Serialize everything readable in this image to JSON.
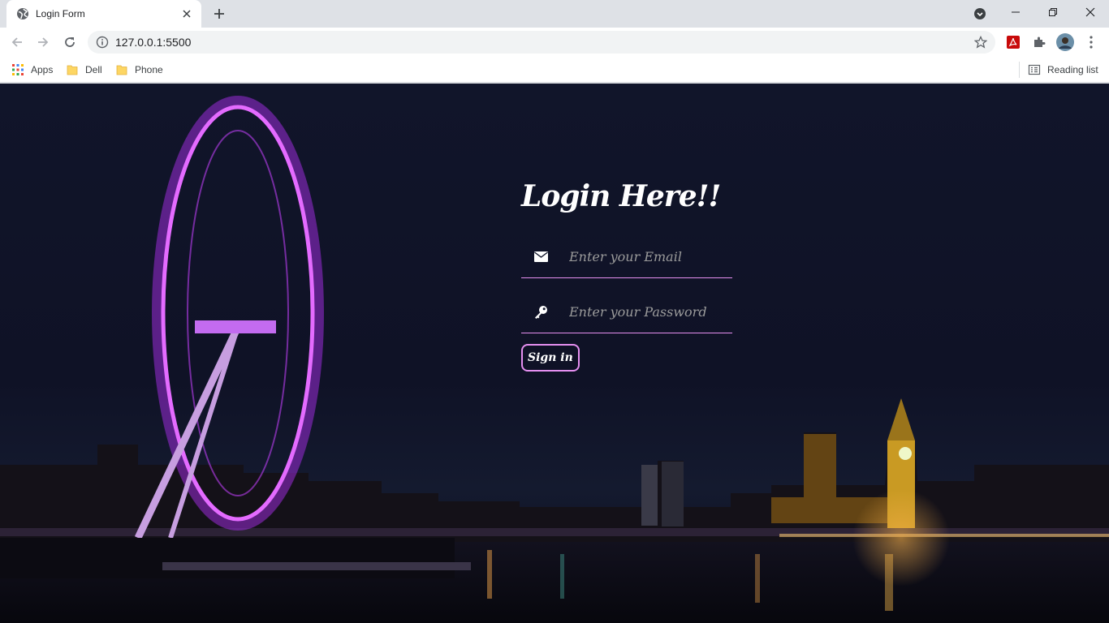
{
  "browser": {
    "tab": {
      "title": "Login Form"
    },
    "address_bar": {
      "url": "127.0.0.1:5500"
    },
    "bookmarks": [
      {
        "label": "Apps",
        "icon": "apps-grid-icon"
      },
      {
        "label": "Dell",
        "icon": "folder-icon"
      },
      {
        "label": "Phone",
        "icon": "folder-icon"
      }
    ],
    "reading_list": {
      "label": "Reading list",
      "icon": "reading-list-icon"
    }
  },
  "login": {
    "title": "Login Here!!",
    "email": {
      "placeholder": "Enter your Email",
      "value": "",
      "icon": "envelope-icon"
    },
    "password": {
      "placeholder": "Enter your Password",
      "value": "",
      "icon": "key-icon"
    },
    "submit_label": "Sign in"
  },
  "colors": {
    "accent": "#e58ff0",
    "page_background": "#11152a",
    "chrome_tabstrip": "#dee1e6"
  }
}
